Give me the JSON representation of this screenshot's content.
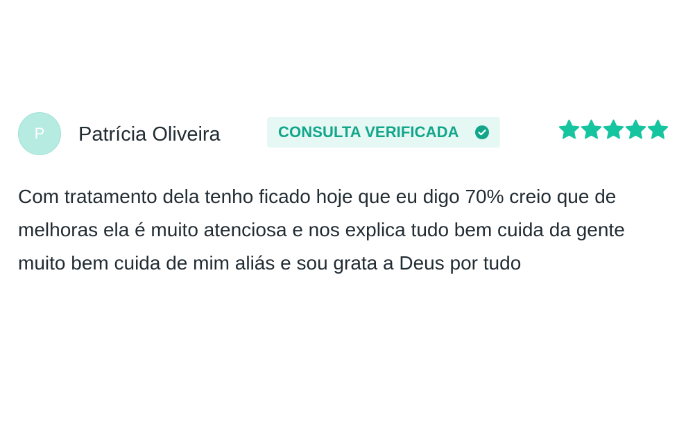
{
  "review": {
    "avatar_initial": "P",
    "author": "Patrícia Oliveira",
    "badge": {
      "label": "CONSULTA VERIFICADA",
      "icon": "check-circle-icon"
    },
    "rating": {
      "stars": 5,
      "max": 5,
      "icon": "star-icon"
    },
    "text": "Com tratamento dela tenho ficado hoje que eu digo 70% creio que de melhoras ela é muito atenciosa e nos explica tudo bem cuida da gente muito bem cuida de mim aliás e sou grata a Deus por tudo"
  },
  "colors": {
    "accent": "#11a68a",
    "star": "#16c4a0",
    "badge_bg": "#e6f8f4",
    "avatar_bg": "#b6ebe2",
    "text": "#222c33"
  }
}
